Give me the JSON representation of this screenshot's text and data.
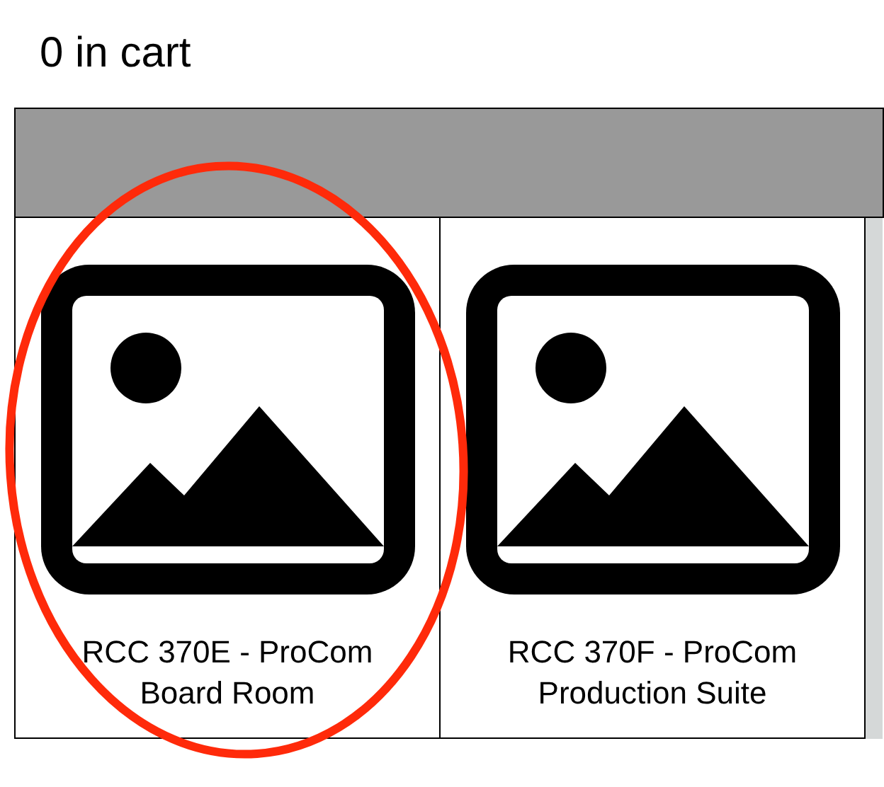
{
  "cart_status": "0 in cart",
  "products": [
    {
      "name": "RCC 370E - ProCom Board Room"
    },
    {
      "name": "RCC 370F - ProCom Production Suite"
    }
  ]
}
